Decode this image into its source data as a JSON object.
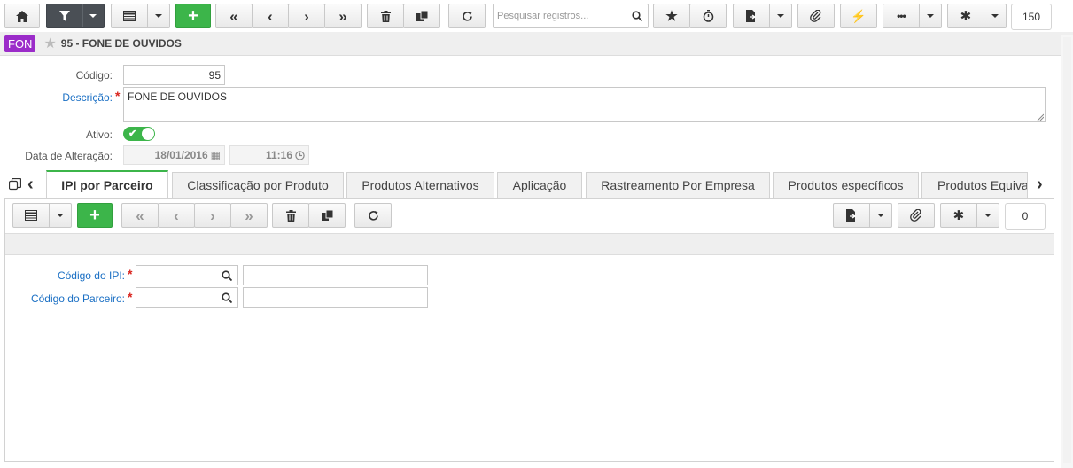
{
  "toolbar": {
    "search_placeholder": "Pesquisar registros...",
    "record_count": "150"
  },
  "record": {
    "badge": "FON",
    "title": "95 - FONE DE OUVIDOS"
  },
  "form": {
    "codigo_label": "Código:",
    "codigo_value": "95",
    "descricao_label": "Descrição:",
    "descricao_value": "FONE DE OUVIDOS",
    "ativo_label": "Ativo:",
    "ativo_value": true,
    "data_label": "Data de Alteração:",
    "data_value": "18/01/2016",
    "hora_value": "11:16"
  },
  "tabs": [
    {
      "label": "IPI por Parceiro",
      "active": true
    },
    {
      "label": "Classificação por Produto",
      "active": false
    },
    {
      "label": "Produtos Alternativos",
      "active": false
    },
    {
      "label": "Aplicação",
      "active": false
    },
    {
      "label": "Rastreamento Por Empresa",
      "active": false
    },
    {
      "label": "Produtos específicos",
      "active": false
    },
    {
      "label": "Produtos Equiva",
      "active": false
    }
  ],
  "subtoolbar": {
    "record_count": "0"
  },
  "subform": {
    "ipi_label": "Código do IPI:",
    "parceiro_label": "Código do Parceiro:",
    "ipi_value": "",
    "parceiro_value": ""
  },
  "colors": {
    "accent_green": "#3cb54a",
    "badge_purple": "#9b2cc9",
    "required_red": "#d9241e",
    "link_blue": "#1a6fc4",
    "dark_button": "#4a4f55"
  }
}
